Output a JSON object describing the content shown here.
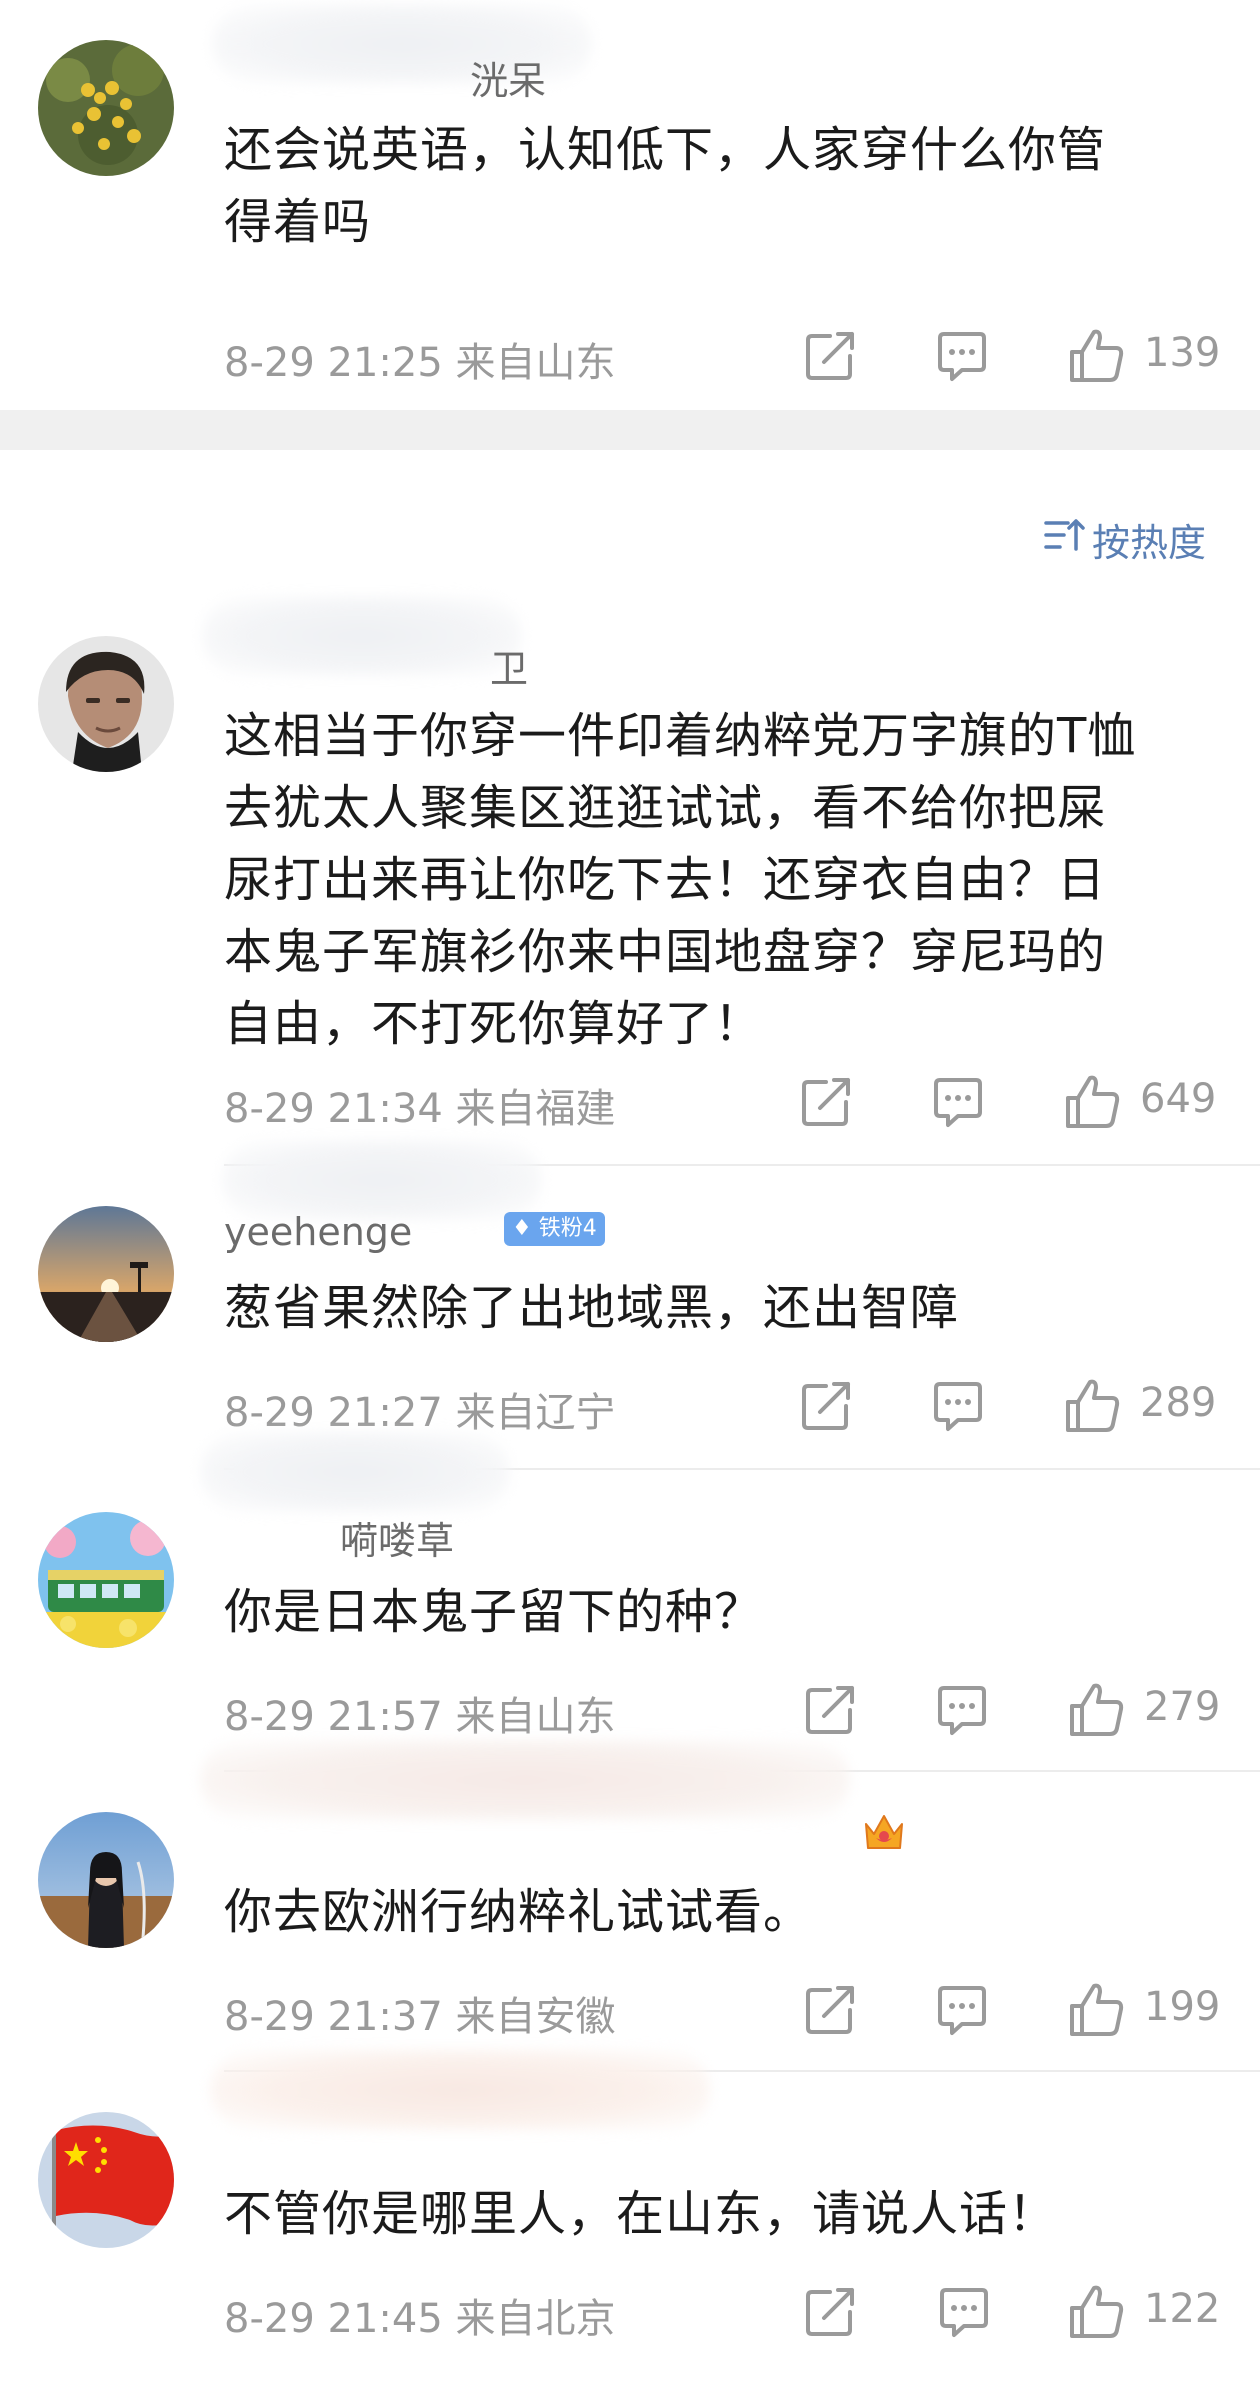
{
  "sort": {
    "label": "按热度",
    "color": "#5a7fb4"
  },
  "colors": {
    "meta": "#9a9a9a",
    "badge": "#6aa5ee",
    "divider": "#ececec"
  },
  "comments": [
    {
      "username_visible": "洸呆",
      "text_lines": [
        "还会说英语，认知低下，人家穿什么你管",
        "得着吗"
      ],
      "time": "8-29 21:25",
      "location": "来自山东",
      "likes": "139",
      "avatar_icon": "yellow-flowers-avatar"
    },
    {
      "username_visible": "卫",
      "text_lines": [
        "这相当于你穿一件印着纳粹党万字旗的T恤",
        "去犹太人聚集区逛逛试试，看不给你把屎",
        "尿打出来再让你吃下去！还穿衣自由？日",
        "本鬼子军旗衫你来中国地盘穿？穿尼玛的",
        "自由，不打死你算好了！"
      ],
      "time": "8-29 21:34",
      "location": "来自福建",
      "likes": "649",
      "avatar_icon": "man-portrait-avatar"
    },
    {
      "username_visible": "yeehenge",
      "badge": "铁粉4",
      "text_lines": [
        "葱省果然除了出地域黑，还出智障"
      ],
      "time": "8-29 21:27",
      "location": "来自辽宁",
      "likes": "289",
      "avatar_icon": "sunset-road-avatar"
    },
    {
      "username_visible": "嗬喽草",
      "text_lines": [
        "你是日本鬼子留下的种？"
      ],
      "time": "8-29 21:57",
      "location": "来自山东",
      "likes": "279",
      "avatar_icon": "green-train-avatar"
    },
    {
      "username_visible": "",
      "text_lines": [
        "你去欧洲行纳粹礼试试看。"
      ],
      "time": "8-29 21:37",
      "location": "来自安徽",
      "likes": "199",
      "avatar_icon": "girl-field-avatar"
    },
    {
      "username_visible": "",
      "text_lines": [
        "不管你是哪里人，在山东，请说人话！"
      ],
      "time": "8-29 21:45",
      "location": "来自北京",
      "likes": "122",
      "avatar_icon": "china-flag-avatar"
    }
  ]
}
